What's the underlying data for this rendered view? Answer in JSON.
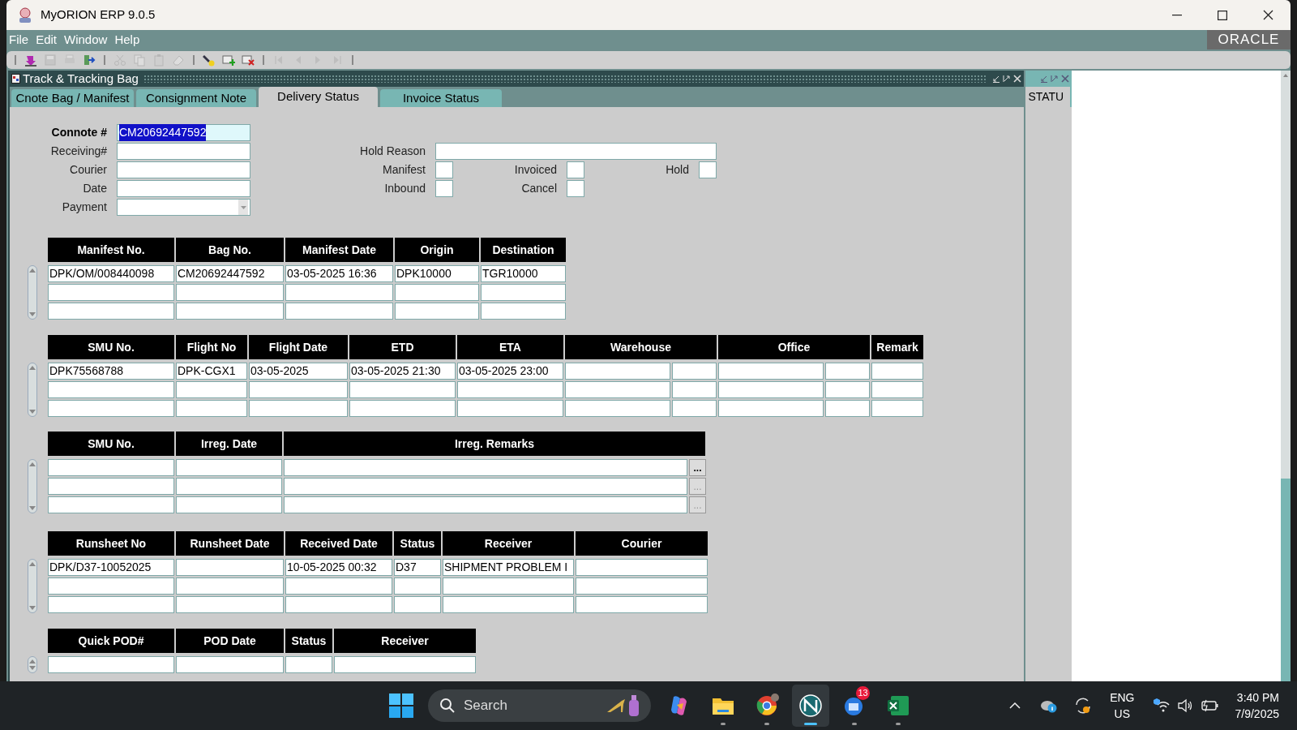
{
  "window": {
    "title": "MyORION ERP 9.0.5"
  },
  "menu": [
    {
      "label": "File"
    },
    {
      "label": "Edit"
    },
    {
      "label": "Window"
    },
    {
      "label": "Help"
    }
  ],
  "brand": "ORACLE",
  "toolbar": [
    {
      "disabled": false
    },
    {
      "disabled": true
    },
    {
      "disabled": true
    },
    {
      "disabled": false
    },
    {
      "disabled": true
    },
    {
      "disabled": true
    },
    {
      "disabled": true
    },
    {
      "disabled": true
    },
    {
      "disabled": false
    },
    {
      "disabled": false
    },
    {
      "disabled": false
    },
    {
      "disabled": true
    },
    {
      "disabled": true
    },
    {
      "disabled": true
    },
    {
      "disabled": true
    }
  ],
  "form_window": {
    "title": "Track & Tracking Bag",
    "tabs": [
      {
        "label": "Cnote Bag / Manifest",
        "selected": false
      },
      {
        "label": "Consignment Note",
        "selected": false
      },
      {
        "label": "Delivery Status",
        "selected": true
      },
      {
        "label": "Invoice Status",
        "selected": false
      }
    ],
    "fields": [
      {
        "label": "Connote #",
        "kind": "text",
        "value": "CM20692447592",
        "focused": true
      },
      {
        "label": "Receiving#",
        "kind": "text",
        "focused": false
      },
      {
        "label": "Courier",
        "kind": "text",
        "focused": false
      },
      {
        "label": "Date",
        "kind": "text",
        "focused": false
      },
      {
        "label": "Payment",
        "kind": "select",
        "focused": false
      }
    ],
    "hold_reason": {
      "label": "Hold Reason"
    },
    "checkboxes": [
      {
        "label": "Manifest",
        "checked": false
      },
      {
        "label": "Invoiced",
        "checked": false
      },
      {
        "label": "Hold",
        "checked": false
      },
      {
        "label": "Inbound",
        "checked": false
      },
      {
        "label": "Cancel",
        "checked": false
      }
    ],
    "tables": [
      {
        "columns": [
          "Manifest No.",
          "Bag No.",
          "Manifest Date",
          "Origin",
          "Destination"
        ],
        "rows": [
          [
            "DPK/OM/008440098",
            "CM20692447592",
            "03-05-2025 16:36",
            "DPK10000",
            "TGR10000"
          ]
        ]
      },
      {
        "columns": [
          "SMU No.",
          "Flight No",
          "Flight Date",
          "ETD",
          "ETA",
          "Warehouse",
          "Office",
          "Remark"
        ],
        "rows": [
          [
            "DPK75568788",
            "DPK-CGX1",
            "03-05-2025",
            "03-05-2025 21:30",
            "03-05-2025 23:00"
          ]
        ]
      },
      {
        "columns": [
          "SMU No.",
          "Irreg. Date",
          "Irreg. Remarks"
        ],
        "row_buttons": [
          {
            "label": "...",
            "disabled": false
          },
          {
            "label": "...",
            "disabled": true
          },
          {
            "label": "...",
            "disabled": true
          }
        ]
      },
      {
        "columns": [
          "Runsheet No",
          "Runsheet Date",
          "Received Date",
          "Status",
          "Receiver",
          "Courier"
        ],
        "rows": [
          [
            "DPK/D37-10052025",
            "",
            "10-05-2025 00:32",
            "D37",
            "SHIPMENT PROBLEM I"
          ]
        ]
      },
      {
        "columns": [
          "Quick POD#",
          "POD Date",
          "Status",
          "Receiver"
        ]
      }
    ]
  },
  "side_window": {
    "tab": "STATU"
  },
  "taskbar": {
    "search_placeholder": "Search",
    "apps": [
      {
        "running": false,
        "active": false
      },
      {
        "running": true,
        "active": false
      },
      {
        "running": true,
        "active": false
      },
      {
        "running": true,
        "active": true
      },
      {
        "running": true,
        "active": false,
        "badge": "13"
      },
      {
        "running": true,
        "active": false
      }
    ],
    "language": "ENG",
    "region": "US",
    "time": "3:40 PM",
    "date": "7/9/2025"
  }
}
